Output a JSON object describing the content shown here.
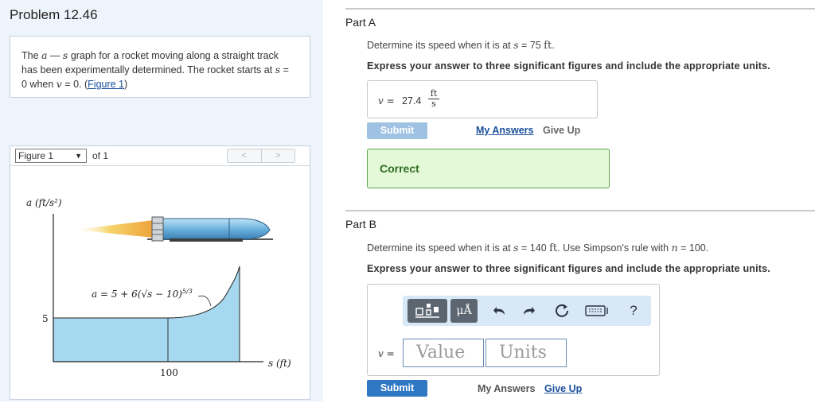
{
  "problem": {
    "title": "Problem 12.46",
    "text_pre": "The ",
    "text_a": "a",
    "text_dash": " — ",
    "text_s": "s",
    "text_mid": " graph for a rocket moving along a straight track has been experimentally determined. The rocket starts at ",
    "text_s2": "s",
    "text_eq0": " = 0 when ",
    "text_v": "v",
    "text_end": " = 0. (",
    "figure_link": "Figure 1",
    "text_close": ")"
  },
  "figure": {
    "select_label": "Figure 1",
    "of_label": "of 1",
    "prev_icon": "chevron-left-icon",
    "next_icon": "chevron-right-icon",
    "y_axis_label": "a (ft/s²)",
    "x_axis_label": "s (ft)",
    "equation": "a = 5 + 6(√s − 10)⁵ᐟ³",
    "equation_text": "a = 5 + 6(√s − 10)",
    "equation_exp": "5/3",
    "y_tick": "5",
    "x_tick": "100"
  },
  "partA": {
    "title": "Part A",
    "q_pre": "Determine its speed when it is at ",
    "q_s": "s",
    "q_eq": " = 75 ",
    "q_unit": "ft",
    "q_end": ".",
    "instruction": "Express your answer to three significant figures and include the appropriate units.",
    "answer_label": "v",
    "answer_eq": " =",
    "answer_value": "27.4",
    "unit_num": "ft",
    "unit_den": "s",
    "submit_label": "Submit",
    "my_answers_label": "My Answers",
    "give_up_label": "Give Up",
    "result_label": "Correct",
    "colors": {
      "correct_bg": "#e3f9d7",
      "correct_border": "#5ca04a",
      "submit_disabled": "#9fc2e2"
    }
  },
  "partB": {
    "title": "Part B",
    "q_pre": "Determine its speed when it is at ",
    "q_s": "s",
    "q_eq": " = 140 ",
    "q_unit": "ft",
    "q_mid": ". Use Simpson's rule with ",
    "q_n": "n",
    "q_end": " = 100.",
    "instruction": "Express your answer to three significant figures and include the appropriate units.",
    "answer_label": "v",
    "answer_eq": " =",
    "value_placeholder": "Value",
    "units_placeholder": "Units",
    "submit_label": "Submit",
    "my_answers_label": "My Answers",
    "give_up_label": "Give Up",
    "toolbar": {
      "template_icon": "fraction-template-icon",
      "units_button": "μÅ",
      "undo_icon": "undo-icon",
      "redo_icon": "redo-icon",
      "reset_icon": "reset-icon",
      "keyboard_icon": "keyboard-icon",
      "help_label": "?"
    },
    "colors": {
      "submit": "#2f78c4"
    }
  }
}
